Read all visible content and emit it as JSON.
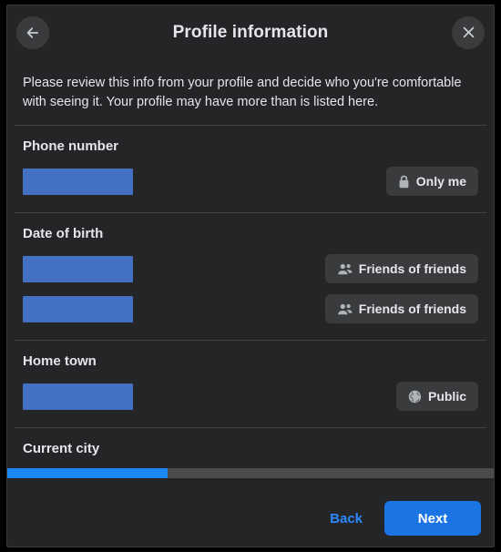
{
  "dialog": {
    "title": "Profile information",
    "back_icon": "arrow-left-icon",
    "close_icon": "close-icon",
    "intro": "Please review this info from your profile and decide who you're comfortable with seeing it. Your profile may have more than is listed here."
  },
  "sections": [
    {
      "title": "Phone number",
      "rows": [
        {
          "audience": "Only me",
          "icon": "lock-icon"
        }
      ]
    },
    {
      "title": "Date of birth",
      "rows": [
        {
          "audience": "Friends of friends",
          "icon": "friends-icon"
        },
        {
          "audience": "Friends of friends",
          "icon": "friends-icon"
        }
      ]
    },
    {
      "title": "Home town",
      "rows": [
        {
          "audience": "Public",
          "icon": "globe-icon"
        }
      ]
    },
    {
      "title": "Current city",
      "rows": []
    }
  ],
  "footer": {
    "progress_percent": 33,
    "back_label": "Back",
    "next_label": "Next"
  },
  "colors": {
    "accent": "#1b74e4",
    "progress": "#1b87f2",
    "redaction": "#4470c4",
    "surface": "#242526",
    "control": "#3a3b3c",
    "link": "#2e89ff"
  }
}
